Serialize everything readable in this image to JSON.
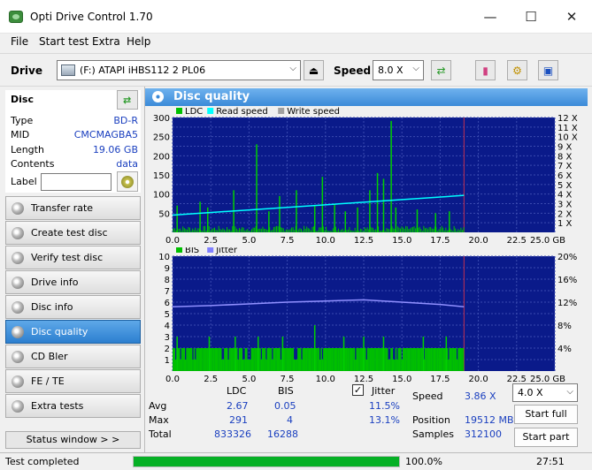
{
  "window": {
    "title": "Opti Drive Control 1.70"
  },
  "menu": [
    "File",
    "Start test",
    "Extra",
    "Help"
  ],
  "toolbar": {
    "drive_label": "Drive",
    "drive_value": "(F:)   ATAPI iHBS112   2 PL06",
    "speed_label": "Speed",
    "speed_value": "8.0 X"
  },
  "disc": {
    "header": "Disc",
    "type_label": "Type",
    "type_value": "BD-R",
    "mid_label": "MID",
    "mid_value": "CMCMAGBA5",
    "length_label": "Length",
    "length_value": "19.06 GB",
    "contents_label": "Contents",
    "contents_value": "data",
    "label_label": "Label",
    "label_value": ""
  },
  "sidebar_buttons": [
    "Transfer rate",
    "Create test disc",
    "Verify test disc",
    "Drive info",
    "Disc info",
    "Disc quality",
    "CD Bler",
    "FE / TE",
    "Extra tests"
  ],
  "active_button": "Disc quality",
  "status_window_label": "Status window > >",
  "panel": {
    "title": "Disc quality"
  },
  "chart_data": [
    {
      "type": "bar",
      "legend": [
        "LDC",
        "Read speed",
        "Write speed"
      ],
      "legend_colors": [
        "#00c000",
        "#00ffff",
        "#a0a0a0"
      ],
      "x_ticks": [
        "0.0",
        "2.5",
        "5.0",
        "7.5",
        "10.0",
        "12.5",
        "15.0",
        "17.5",
        "20.0",
        "22.5",
        "25.0 GB"
      ],
      "y_ticks_left": [
        "50",
        "100",
        "150",
        "200",
        "250",
        "300"
      ],
      "y_ticks_right": [
        "1 X",
        "2 X",
        "3 X",
        "4 X",
        "5 X",
        "6 X",
        "7 X",
        "8 X",
        "9 X",
        "10 X",
        "11 X",
        "12 X"
      ],
      "xlim": [
        0,
        25
      ],
      "ylim": [
        0,
        300
      ],
      "data_end_gb": 19.06,
      "ldc_spikes": [
        [
          0.3,
          70
        ],
        [
          1.8,
          80
        ],
        [
          2.3,
          65
        ],
        [
          4.0,
          110
        ],
        [
          5.5,
          230
        ],
        [
          6.3,
          55
        ],
        [
          7.0,
          95
        ],
        [
          8.1,
          110
        ],
        [
          9.3,
          70
        ],
        [
          9.8,
          145
        ],
        [
          10.6,
          75
        ],
        [
          11.3,
          55
        ],
        [
          12.1,
          65
        ],
        [
          12.9,
          110
        ],
        [
          13.4,
          155
        ],
        [
          13.8,
          140
        ],
        [
          14.3,
          291
        ],
        [
          14.6,
          65
        ],
        [
          16.0,
          60
        ],
        [
          17.2,
          50
        ],
        [
          18.1,
          55
        ]
      ],
      "read_speed_x": [
        0,
        19.06
      ],
      "read_speed_y": [
        1.8,
        3.86
      ]
    },
    {
      "type": "bar",
      "legend": [
        "BIS",
        "Jitter"
      ],
      "legend_colors": [
        "#00c000",
        "#8080ff"
      ],
      "x_ticks": [
        "0.0",
        "2.5",
        "5.0",
        "7.5",
        "10.0",
        "12.5",
        "15.0",
        "17.5",
        "20.0",
        "22.5",
        "25.0 GB"
      ],
      "y_ticks_left": [
        "1",
        "2",
        "3",
        "4",
        "5",
        "6",
        "7",
        "8",
        "9",
        "10"
      ],
      "y_ticks_right": [
        "4%",
        "8%",
        "12%",
        "16%",
        "20%"
      ],
      "xlim": [
        0,
        25
      ],
      "ylim": [
        0,
        10
      ],
      "data_end_gb": 19.06,
      "bis_spikes": [
        [
          0.3,
          3
        ],
        [
          2.4,
          3
        ],
        [
          4.1,
          3
        ],
        [
          5.6,
          3
        ],
        [
          7.2,
          3
        ],
        [
          9.3,
          4
        ],
        [
          11.2,
          3
        ],
        [
          12.5,
          3
        ],
        [
          13.8,
          3
        ],
        [
          16.4,
          3
        ],
        [
          17.9,
          3
        ]
      ],
      "jitter_percent_x": [
        0,
        2.5,
        5,
        7.5,
        10,
        12.5,
        15,
        17.5,
        19.06
      ],
      "jitter_percent_y": [
        11.2,
        11.4,
        11.7,
        12.0,
        12.2,
        12.4,
        12.0,
        11.6,
        11.2
      ]
    }
  ],
  "stats": {
    "col_ldc": "LDC",
    "col_bis": "BIS",
    "jitter_label": "Jitter",
    "jitter_checked": true,
    "avg_label": "Avg",
    "avg_ldc": "2.67",
    "avg_bis": "0.05",
    "avg_jitter": "11.5%",
    "max_label": "Max",
    "max_ldc": "291",
    "max_bis": "4",
    "max_jitter": "13.1%",
    "total_label": "Total",
    "total_ldc": "833326",
    "total_bis": "16288",
    "speed_label": "Speed",
    "speed_value": "3.86 X",
    "speed_select": "4.0 X",
    "position_label": "Position",
    "position_value": "19512 MB",
    "samples_label": "Samples",
    "samples_value": "312100",
    "start_full": "Start full",
    "start_part": "Start part"
  },
  "statusbar": {
    "status": "Test completed",
    "progress": 100,
    "percent": "100.0%",
    "time": "27:51"
  }
}
